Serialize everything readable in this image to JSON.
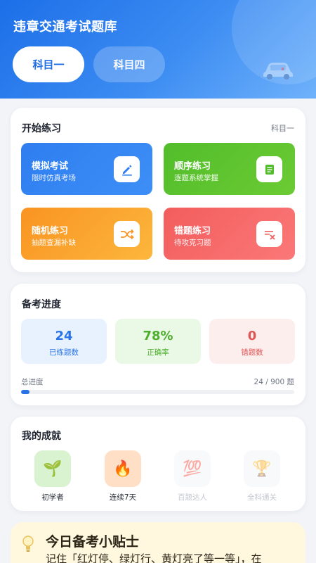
{
  "header": {
    "app_title": "违章交通考试题库",
    "tabs": [
      {
        "label": "科目一",
        "active": true
      },
      {
        "label": "科目四",
        "active": false
      }
    ]
  },
  "practice": {
    "title": "开始练习",
    "subject_tag": "科目一",
    "tiles": [
      {
        "title": "模拟考试",
        "subtitle": "限时仿真考场",
        "icon": "pencil-edit-icon",
        "color": "#2f7df0"
      },
      {
        "title": "顺序练习",
        "subtitle": "逐题系统掌握",
        "icon": "document-list-icon",
        "color": "#52bd2b"
      },
      {
        "title": "随机练习",
        "subtitle": "抽题查漏补缺",
        "icon": "shuffle-icon",
        "color": "#f99422"
      },
      {
        "title": "错题练习",
        "subtitle": "待攻克习题",
        "icon": "error-list-icon",
        "color": "#f25d5d"
      }
    ]
  },
  "progress": {
    "title": "备考进度",
    "stats": [
      {
        "value": "24",
        "label": "已练题数"
      },
      {
        "value": "78%",
        "label": "正确率"
      },
      {
        "value": "0",
        "label": "错题数"
      }
    ],
    "overall_label": "总进度",
    "overall_value": "24 / 900 题",
    "done": 24,
    "total": 900
  },
  "achievements": {
    "title": "我的成就",
    "items": [
      {
        "emoji": "🌱",
        "label": "初学者",
        "unlocked": true,
        "icon": "seedling-icon"
      },
      {
        "emoji": "🔥",
        "label": "连续7天",
        "unlocked": true,
        "icon": "fire-icon"
      },
      {
        "emoji": "💯",
        "label": "百题达人",
        "unlocked": false,
        "icon": "hundred-points-icon"
      },
      {
        "emoji": "🏆",
        "label": "全科通关",
        "unlocked": false,
        "icon": "trophy-icon"
      }
    ]
  },
  "tips": {
    "title": "今日备考小贴士",
    "text": "记住「红灯停、绿灯行、黄灯亮了等一等」，在"
  }
}
